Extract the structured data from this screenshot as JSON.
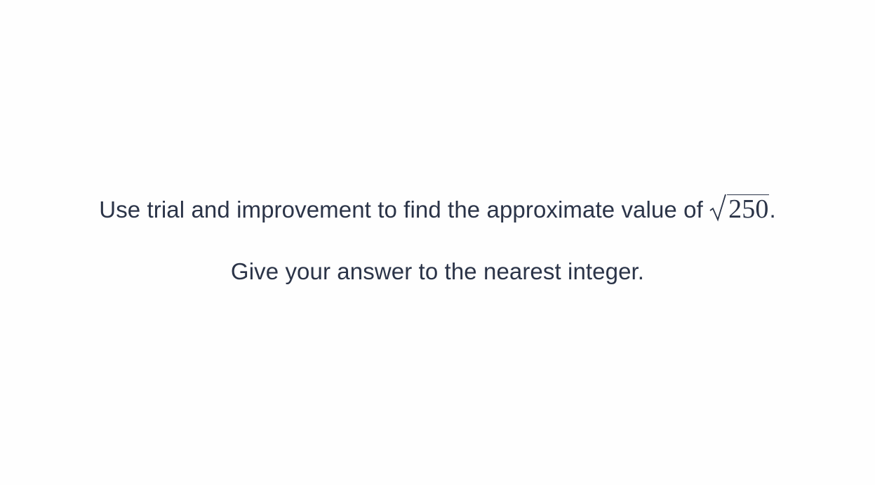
{
  "question": {
    "line1_text": "Use trial and improvement to find the approximate value of ",
    "radicand": "250",
    "line1_end": ".",
    "line2_text": "Give your answer to the nearest integer."
  },
  "colors": {
    "text": "#2b3448",
    "background": "#fefefe"
  },
  "icons": [
    "square-root-symbol"
  ]
}
